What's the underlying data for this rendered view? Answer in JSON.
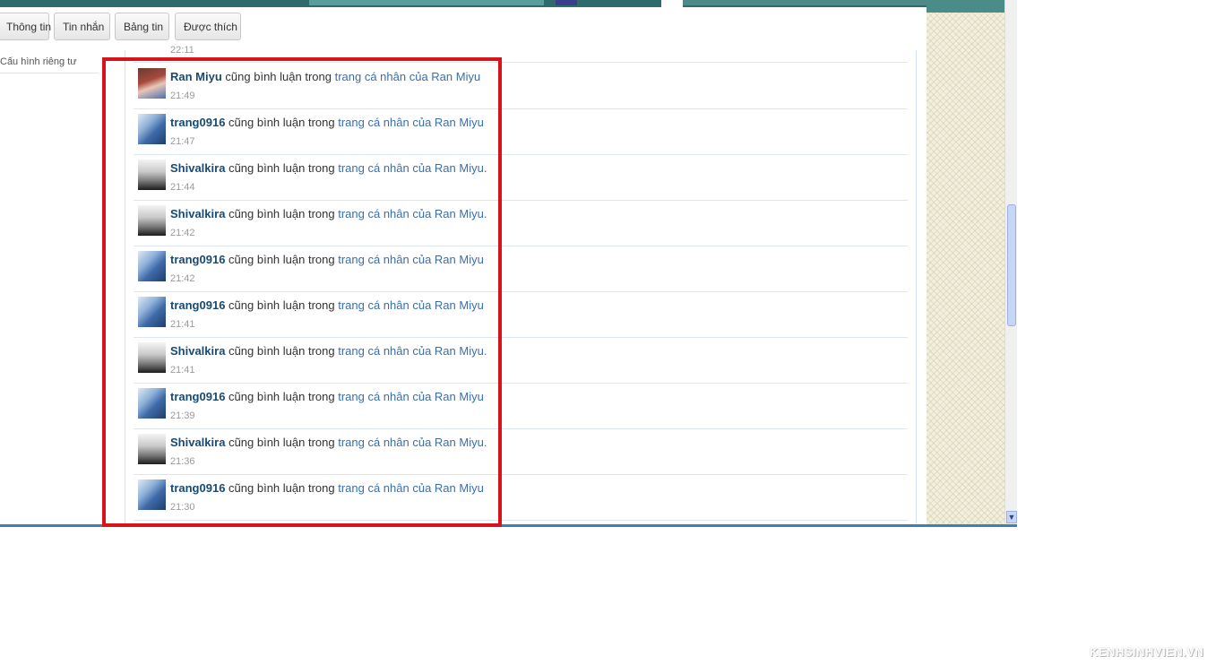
{
  "tabs": [
    "Thông tin",
    "Tin nhắn",
    "Bảng tin",
    "Được thích"
  ],
  "left_menu": [
    "Cấu hình riêng tư"
  ],
  "previous_item_time": "22:11",
  "feed": [
    {
      "user": "Ran Miyu",
      "avatar": "ran-miyu-avatar",
      "action": "cũng bình luận trong",
      "target": "trang cá nhân của Ran Miyu",
      "time": "21:49"
    },
    {
      "user": "trang0916",
      "avatar": "trang0916-avatar",
      "action": "cũng bình luận trong",
      "target": "trang cá nhân của Ran Miyu",
      "time": "21:47"
    },
    {
      "user": "Shivalkira",
      "avatar": "shivalkira-avatar",
      "action": "cũng bình luận trong",
      "target": "trang cá nhân của Ran Miyu.",
      "time": "21:44"
    },
    {
      "user": "Shivalkira",
      "avatar": "shivalkira-avatar",
      "action": "cũng bình luận trong",
      "target": "trang cá nhân của Ran Miyu.",
      "time": "21:42"
    },
    {
      "user": "trang0916",
      "avatar": "trang0916-avatar",
      "action": "cũng bình luận trong",
      "target": "trang cá nhân của Ran Miyu",
      "time": "21:42"
    },
    {
      "user": "trang0916",
      "avatar": "trang0916-avatar",
      "action": "cũng bình luận trong",
      "target": "trang cá nhân của Ran Miyu",
      "time": "21:41"
    },
    {
      "user": "Shivalkira",
      "avatar": "shivalkira-avatar",
      "action": "cũng bình luận trong",
      "target": "trang cá nhân của Ran Miyu.",
      "time": "21:41"
    },
    {
      "user": "trang0916",
      "avatar": "trang0916-avatar",
      "action": "cũng bình luận trong",
      "target": "trang cá nhân của Ran Miyu",
      "time": "21:39"
    },
    {
      "user": "Shivalkira",
      "avatar": "shivalkira-avatar",
      "action": "cũng bình luận trong",
      "target": "trang cá nhân của Ran Miyu.",
      "time": "21:36"
    },
    {
      "user": "trang0916",
      "avatar": "trang0916-avatar",
      "action": "cũng bình luận trong",
      "target": "trang cá nhân của Ran Miyu",
      "time": "21:30"
    }
  ],
  "watermark": "KENHSINHVIEN.VN",
  "colors": {
    "highlight": "#d8141b",
    "username": "#184a73",
    "link": "#3b6ea8",
    "header": "#2f6b6b"
  }
}
